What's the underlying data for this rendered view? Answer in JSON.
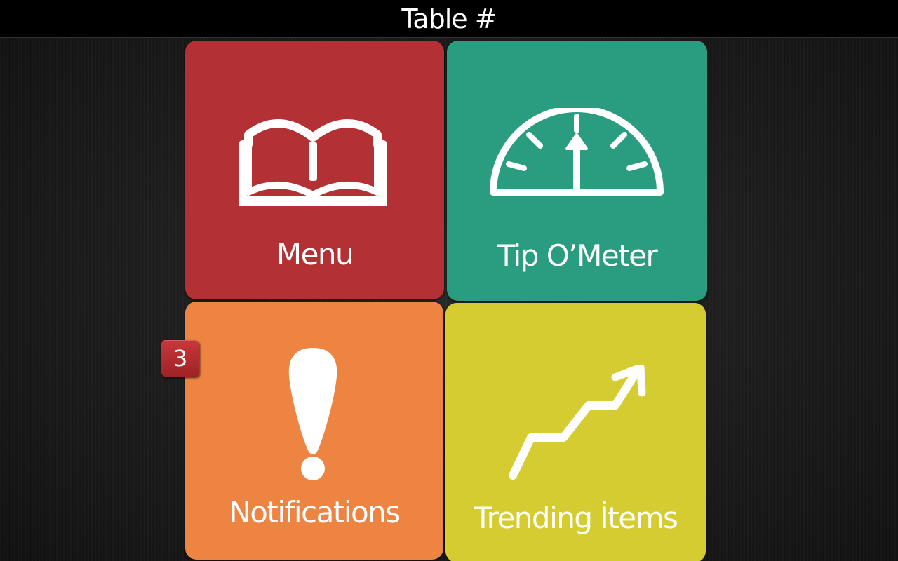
{
  "header": {
    "title": "Table #"
  },
  "tiles": {
    "menu": {
      "label": "Menu",
      "icon": "open-book-icon",
      "color": "#b33034"
    },
    "tip": {
      "label": "Tip O’Meter",
      "icon": "gauge-icon",
      "color": "#2a9d80"
    },
    "notifications": {
      "label": "Notifications",
      "icon": "exclamation-icon",
      "color": "#ed8441",
      "badge_count": "3"
    },
    "trending": {
      "label": "Trending İtems",
      "icon": "trend-up-arrow-icon",
      "color": "#d5cc32"
    }
  }
}
